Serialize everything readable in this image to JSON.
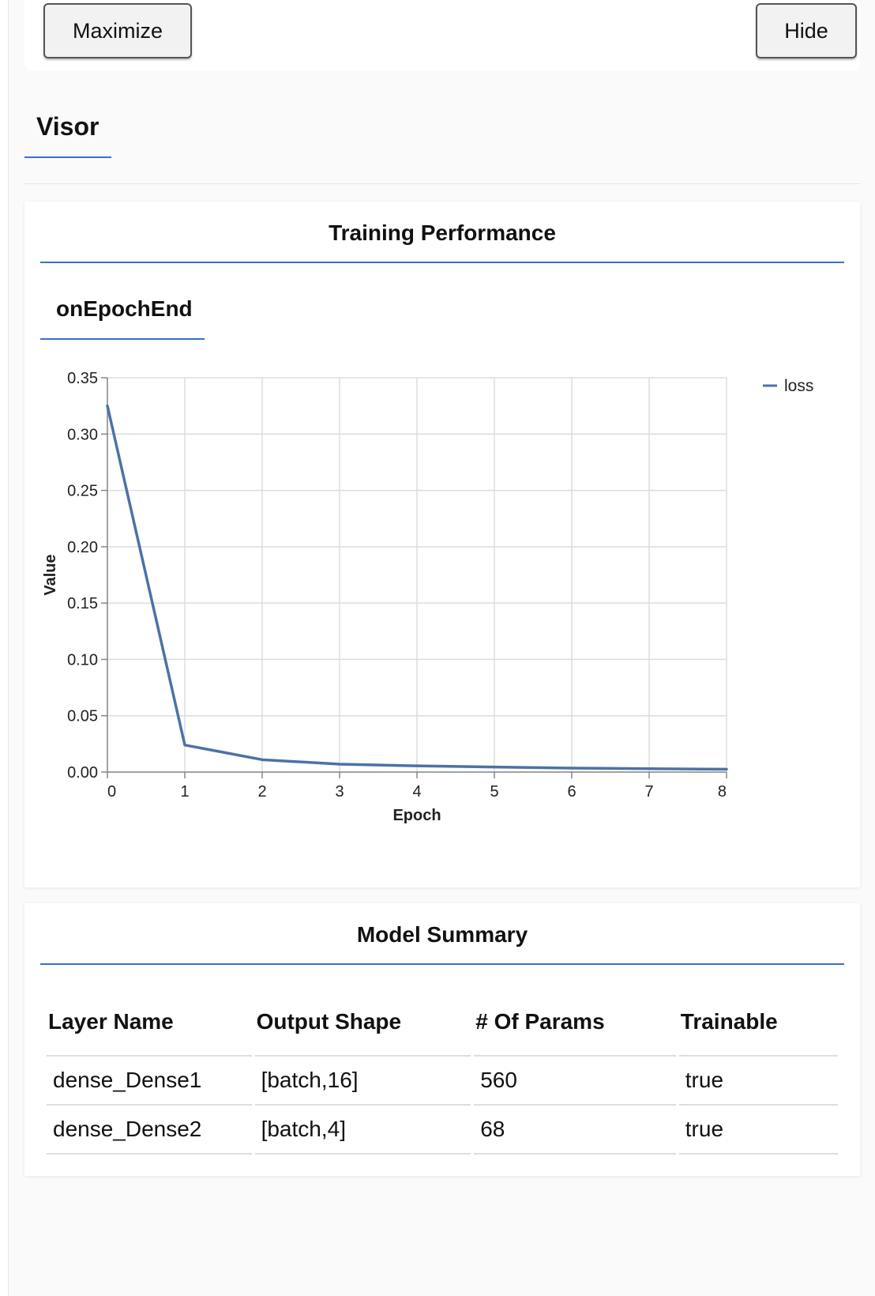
{
  "controls": {
    "maximize_label": "Maximize",
    "hide_label": "Hide"
  },
  "visor": {
    "tab_label": "Visor"
  },
  "training": {
    "card_title": "Training Performance",
    "subtab_label": "onEpochEnd"
  },
  "chart_data": {
    "type": "line",
    "xlabel": "Epoch",
    "ylabel": "Value",
    "x": [
      0,
      1,
      2,
      3,
      4,
      5,
      6,
      7,
      8
    ],
    "series": [
      {
        "name": "loss",
        "color": "#4c72a6",
        "values": [
          0.325,
          0.024,
          0.011,
          0.007,
          0.0055,
          0.0045,
          0.0035,
          0.003,
          0.0025
        ]
      }
    ],
    "xlim": [
      0,
      8
    ],
    "ylim": [
      0,
      0.35
    ],
    "xticks": [
      0,
      1,
      2,
      3,
      4,
      5,
      6,
      7,
      8
    ],
    "yticks": [
      0,
      0.05,
      0.1,
      0.15,
      0.2,
      0.25,
      0.3,
      0.35
    ],
    "ytick_labels": [
      "0.00",
      "0.05",
      "0.10",
      "0.15",
      "0.20",
      "0.25",
      "0.30",
      "0.35"
    ],
    "grid": true,
    "legend": "top-right"
  },
  "model": {
    "card_title": "Model Summary",
    "columns": [
      "Layer Name",
      "Output Shape",
      "# Of Params",
      "Trainable"
    ],
    "rows": [
      [
        "dense_Dense1",
        "[batch,16]",
        "560",
        "true"
      ],
      [
        "dense_Dense2",
        "[batch,4]",
        "68",
        "true"
      ]
    ]
  }
}
